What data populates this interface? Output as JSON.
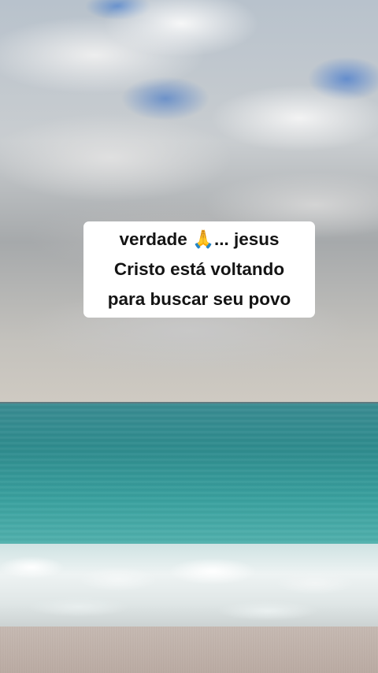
{
  "caption": {
    "line1": "verdade 🙏... jesus",
    "line2": "Cristo está voltando",
    "line3": "para buscar seu povo"
  },
  "colors": {
    "caption_background": "#ffffff",
    "caption_text": "#141414",
    "sea": "#2f8c8e",
    "sky_blue": "#5f8fcf"
  }
}
